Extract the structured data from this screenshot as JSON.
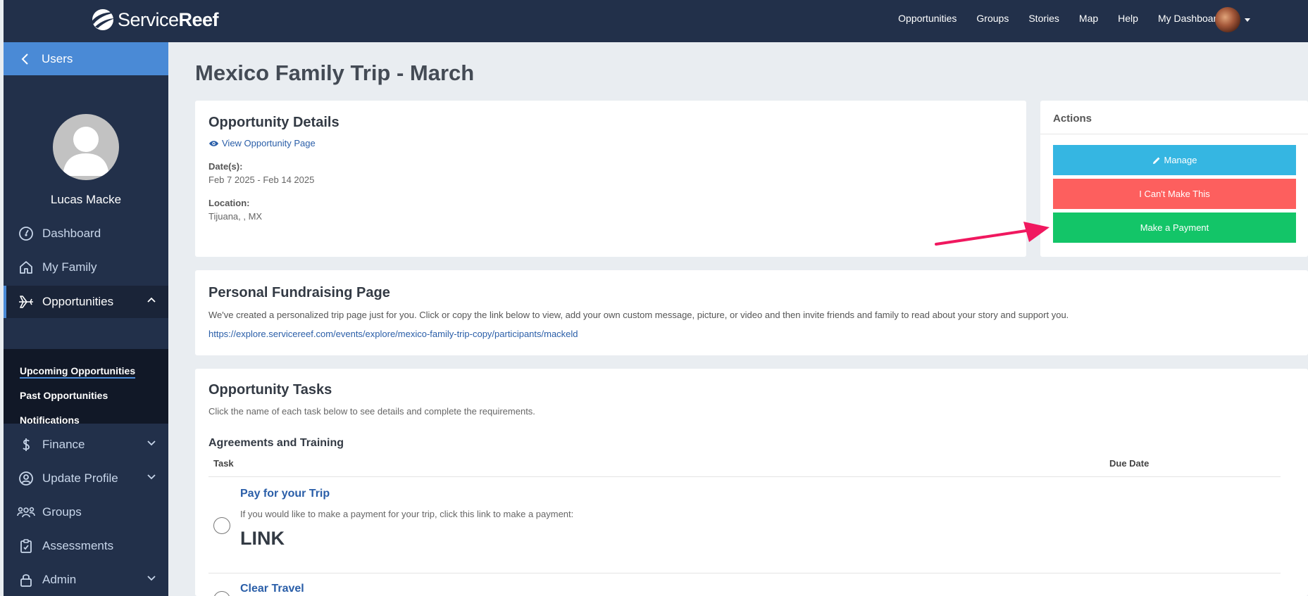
{
  "brand": {
    "name_regular": "Service",
    "name_bold": "Reef"
  },
  "topnav": [
    "Opportunities",
    "Groups",
    "Stories",
    "Map",
    "Help",
    "My Dashboard"
  ],
  "sidebar": {
    "back_label": "Users",
    "profile_name": "Lucas Macke",
    "items": [
      {
        "label": "Dashboard",
        "icon": "gauge-icon"
      },
      {
        "label": "My Family",
        "icon": "home-icon"
      },
      {
        "label": "Opportunities",
        "icon": "plane-icon"
      },
      {
        "label": "Finance",
        "icon": "dollar-icon"
      },
      {
        "label": "Update Profile",
        "icon": "user-circle-icon"
      },
      {
        "label": "Groups",
        "icon": "users-icon"
      },
      {
        "label": "Assessments",
        "icon": "clipboard-icon"
      },
      {
        "label": "Admin",
        "icon": "lock-icon"
      }
    ],
    "submenu": [
      "Upcoming Opportunities",
      "Past Opportunities",
      "Notifications"
    ]
  },
  "page_title": "Mexico Family Trip - March",
  "details": {
    "title": "Opportunity Details",
    "view_link": "View Opportunity Page",
    "dates_label": "Date(s):",
    "dates_value": "Feb 7 2025 - Feb 14 2025",
    "location_label": "Location:",
    "location_value": "Tijuana, , MX"
  },
  "actions": {
    "title": "Actions",
    "manage": "Manage",
    "cant_make": "I Can't Make This",
    "payment": "Make a Payment",
    "colors": {
      "manage": "#35b6e2",
      "cant_make": "#fd5f5e",
      "payment": "#13c568",
      "arrow": "#f0185f"
    }
  },
  "fundraising": {
    "title": "Personal Fundraising Page",
    "description": "We've created a personalized trip page just for you. Click or copy the link below to view, add your own custom message, picture, or video and then invite friends and family to read about your story and support you.",
    "link": "https://explore.servicereef.com/events/explore/mexico-family-trip-copy/participants/mackeld"
  },
  "tasks": {
    "title": "Opportunity Tasks",
    "subtitle": "Click the name of each task below to see details and complete the requirements.",
    "section": "Agreements and Training",
    "col_task": "Task",
    "col_due": "Due Date",
    "items": [
      {
        "title": "Pay for your Trip",
        "description": "If you would like to make a payment for your trip, click this link to make a payment:",
        "extra": "LINK"
      },
      {
        "title": "Clear Travel"
      }
    ]
  }
}
